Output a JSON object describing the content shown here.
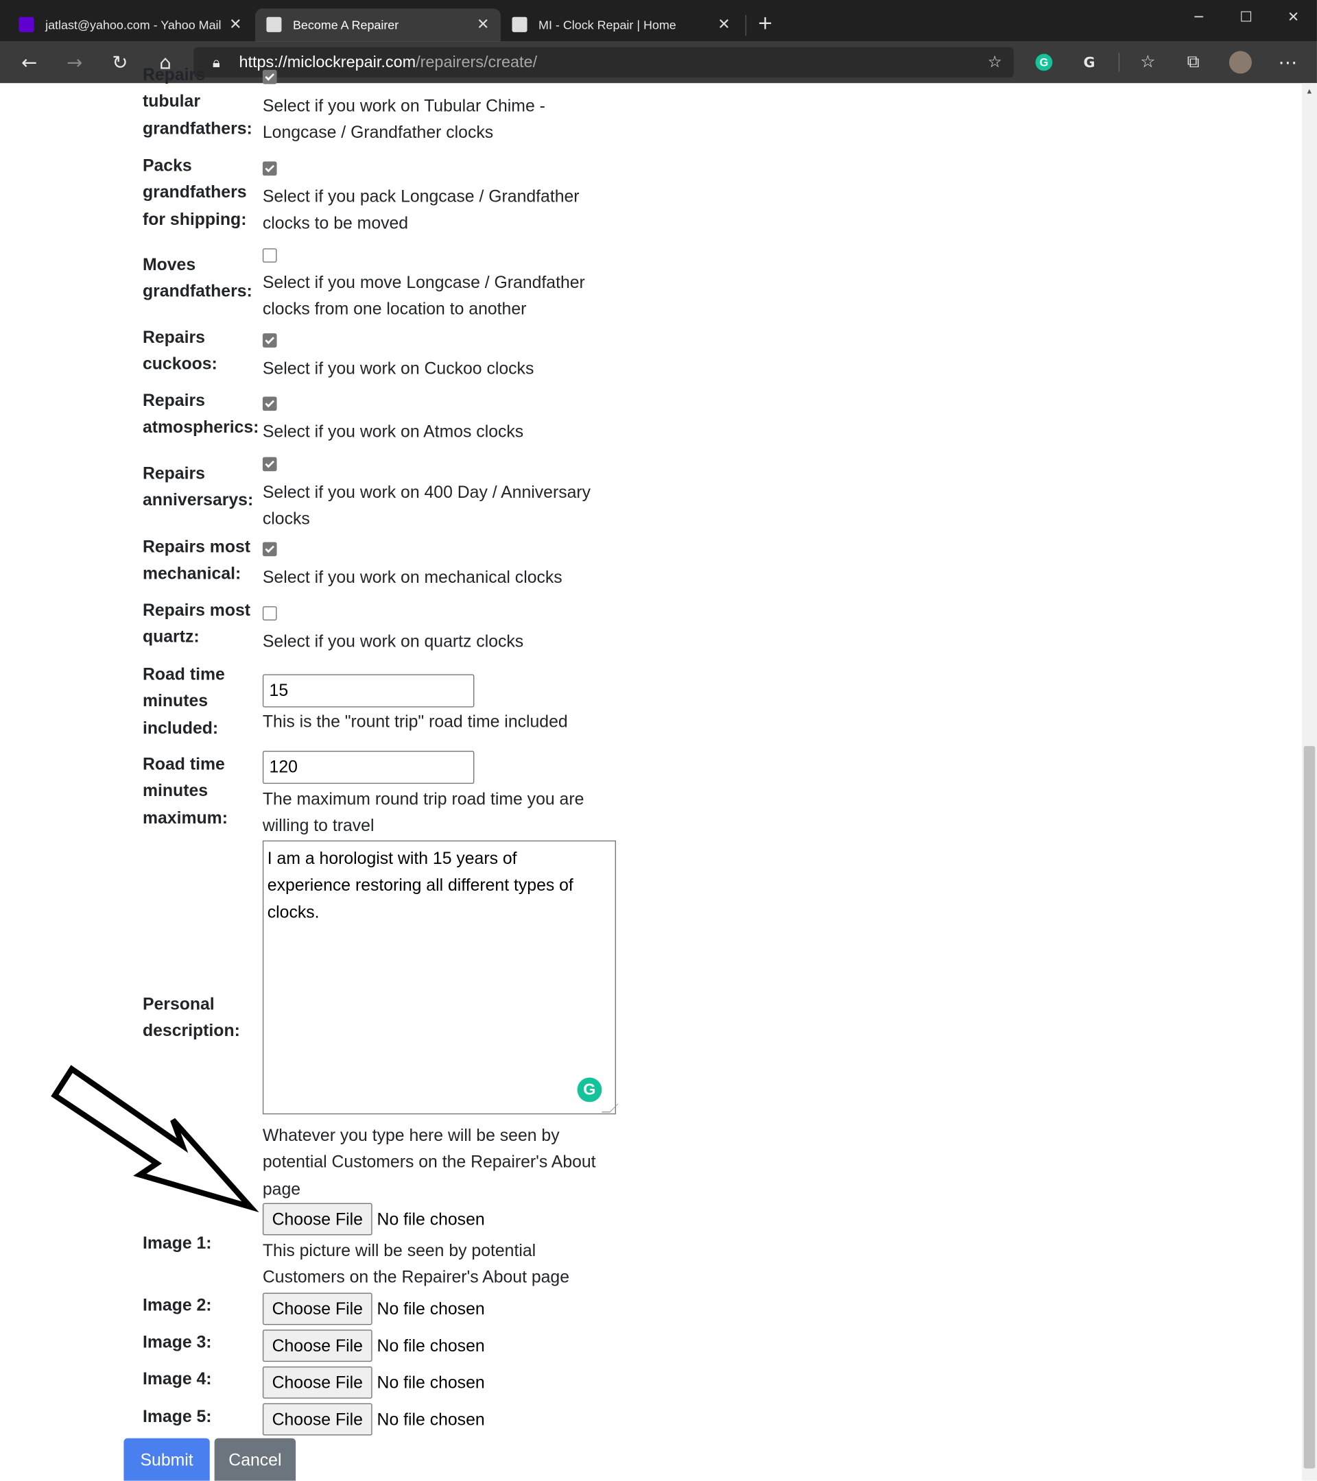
{
  "browser": {
    "tabs": [
      {
        "title": "jatlast@yahoo.com - Yahoo Mail",
        "active": false,
        "favicon": "yahoo-mail-icon"
      },
      {
        "title": "Become A Repairer",
        "active": true,
        "favicon": "clock-icon"
      },
      {
        "title": "MI - Clock Repair | Home",
        "active": false,
        "favicon": "clock-icon"
      }
    ],
    "url_host": "https://miclockrepair.com",
    "url_path": "/repairers/create/"
  },
  "form": {
    "rows": [
      {
        "label": "Repairs tubular grandfathers:",
        "checked": true,
        "help": "Select if you work on Tubular Chime - Longcase / Grandfather clocks"
      },
      {
        "label": "Packs grandfathers for shipping:",
        "checked": true,
        "help": "Select if you pack Longcase / Grandfather clocks to be moved"
      },
      {
        "label": "Moves grandfathers:",
        "checked": false,
        "help": "Select if you move Longcase / Grandfather clocks from one location to another"
      },
      {
        "label": "Repairs cuckoos:",
        "checked": true,
        "help": "Select if you work on Cuckoo clocks"
      },
      {
        "label": "Repairs atmospherics:",
        "checked": true,
        "help": "Select if you work on Atmos clocks"
      },
      {
        "label": "Repairs anniversarys:",
        "checked": true,
        "help": "Select if you work on 400 Day / Anniversary clocks"
      },
      {
        "label": "Repairs most mechanical:",
        "checked": true,
        "help": "Select if you work on mechanical clocks"
      },
      {
        "label": "Repairs most quartz:",
        "checked": false,
        "help": "Select if you work on quartz clocks"
      }
    ],
    "road_included": {
      "label": "Road time minutes included:",
      "value": "15",
      "help": "This is the \"rount trip\" road time included"
    },
    "road_max": {
      "label": "Road time minutes maximum:",
      "value": "120",
      "help": "The maximum round trip road time you are willing to travel"
    },
    "description": {
      "label": "Personal description:",
      "value": "I am a horologist with 15 years of experience restoring all different types of clocks.",
      "help": "Whatever you type here will be seen by potential Customers on the Repairer's About page"
    },
    "images": [
      {
        "label": "Image 1:",
        "help": "This picture will be seen by potential Customers on the Repairer's About page"
      },
      {
        "label": "Image 2:"
      },
      {
        "label": "Image 3:"
      },
      {
        "label": "Image 4:"
      },
      {
        "label": "Image 5:"
      }
    ],
    "choose_file": "Choose File",
    "no_file": "No file chosen",
    "submit": "Submit",
    "cancel": "Cancel"
  },
  "colors": {
    "submit": "#4a7ff0",
    "cancel": "#6c757d",
    "checkbox": "#767676"
  }
}
